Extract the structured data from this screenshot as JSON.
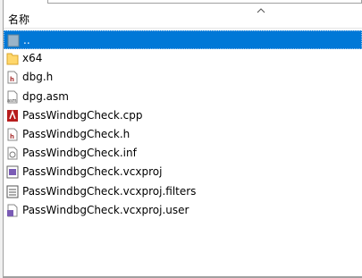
{
  "header": {
    "name_label": "名称"
  },
  "files": [
    {
      "name": "..",
      "icon": "parent-folder-icon",
      "selected": true
    },
    {
      "name": "x64",
      "icon": "folder-icon"
    },
    {
      "name": "dbg.h",
      "icon": "header-file-icon"
    },
    {
      "name": "dpg.asm",
      "icon": "asm-file-icon"
    },
    {
      "name": "PassWindbgCheck.cpp",
      "icon": "cpp-file-icon"
    },
    {
      "name": "PassWindbgCheck.h",
      "icon": "header-file-icon"
    },
    {
      "name": "PassWindbgCheck.inf",
      "icon": "inf-file-icon"
    },
    {
      "name": "PassWindbgCheck.vcxproj",
      "icon": "vcxproj-file-icon"
    },
    {
      "name": "PassWindbgCheck.vcxproj.filters",
      "icon": "filters-file-icon"
    },
    {
      "name": "PassWindbgCheck.vcxproj.user",
      "icon": "user-file-icon"
    }
  ],
  "colors": {
    "selection": "#0078d7",
    "folder": "#ffd76b"
  }
}
